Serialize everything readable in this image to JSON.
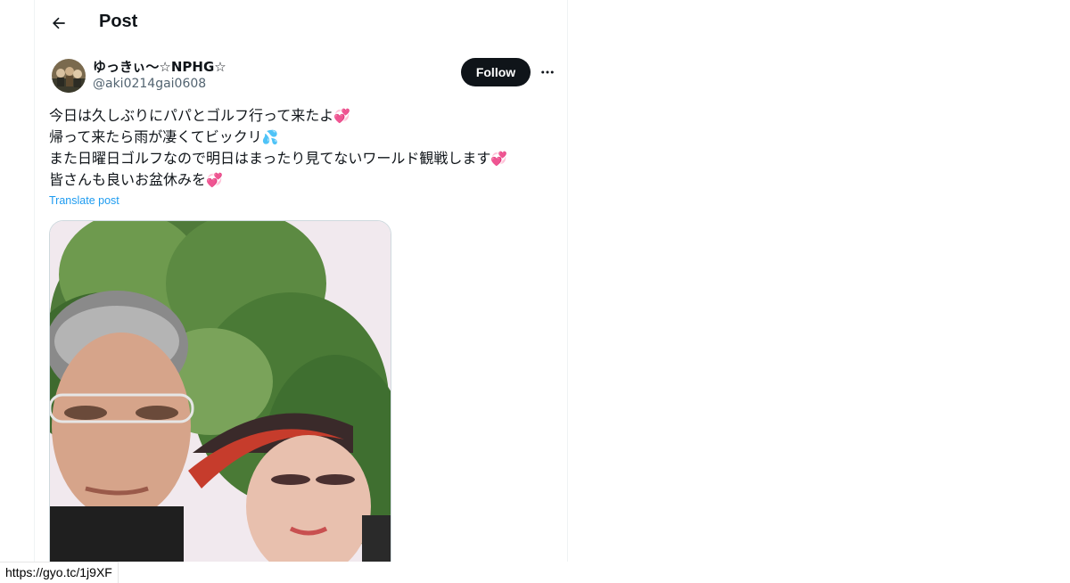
{
  "header": {
    "back_icon": "arrow-left-icon",
    "title": "Post"
  },
  "author": {
    "display_name": "ゆっきぃ〜☆NPHG☆",
    "handle": "@aki0214gai0608",
    "avatar": "avatar"
  },
  "actions": {
    "follow_label": "Follow",
    "more_icon": "more-horizontal-icon"
  },
  "post": {
    "lines": [
      {
        "text": "今日は久しぶりにパパとゴルフ行って来たよ",
        "emoji": "💞"
      },
      {
        "text": "帰って来たら雨が凄くてビックリ",
        "emoji": "💦"
      },
      {
        "text": "また日曜日ゴルフなので明日はまったり見てないワールド観戦します",
        "emoji": "💞"
      },
      {
        "text": "皆さんも良いお盆休みを",
        "emoji": "💞"
      }
    ],
    "translate_label": "Translate post"
  },
  "colors": {
    "accent": "#1d9bf0",
    "text": "#0f1419",
    "secondary": "#536471",
    "border": "#eff3f4"
  },
  "status_bar": {
    "url": "https://gyo.tc/1j9XF"
  }
}
